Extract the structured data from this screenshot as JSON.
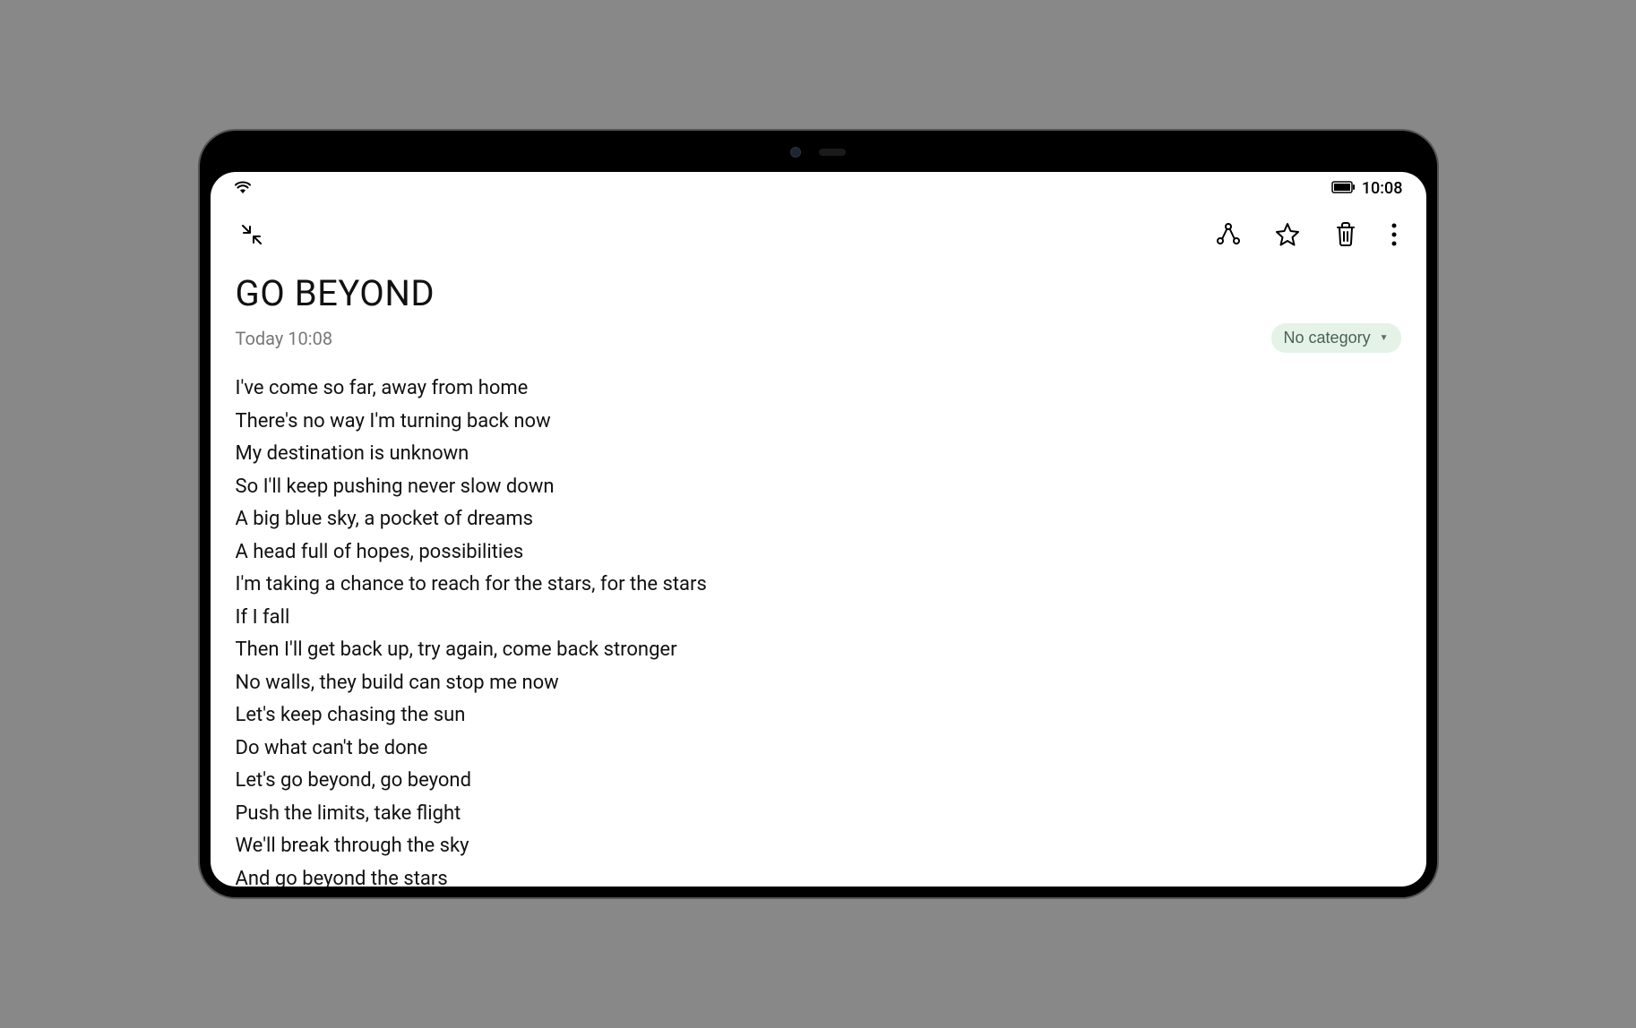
{
  "status_bar": {
    "time": "10:08"
  },
  "note": {
    "title": "GO BEYOND",
    "timestamp": "Today 10:08",
    "category_label": "No category",
    "body_lines": [
      "I've come so far, away from home",
      "There's no way I'm turning back now",
      "My destination is unknown",
      "So I'll keep pushing never slow down",
      "A big blue sky, a pocket of dreams",
      "A head full of hopes, possibilities",
      "I'm taking a chance to reach for the stars, for the stars",
      "If I fall",
      "Then I'll get back up, try again, come back stronger",
      "No walls, they build can stop me now",
      "Let's keep chasing the sun",
      "Do what can't be done",
      "Let's go beyond, go beyond",
      "Push the limits, take flight",
      "We'll break through the sky",
      "And go beyond the stars"
    ]
  }
}
